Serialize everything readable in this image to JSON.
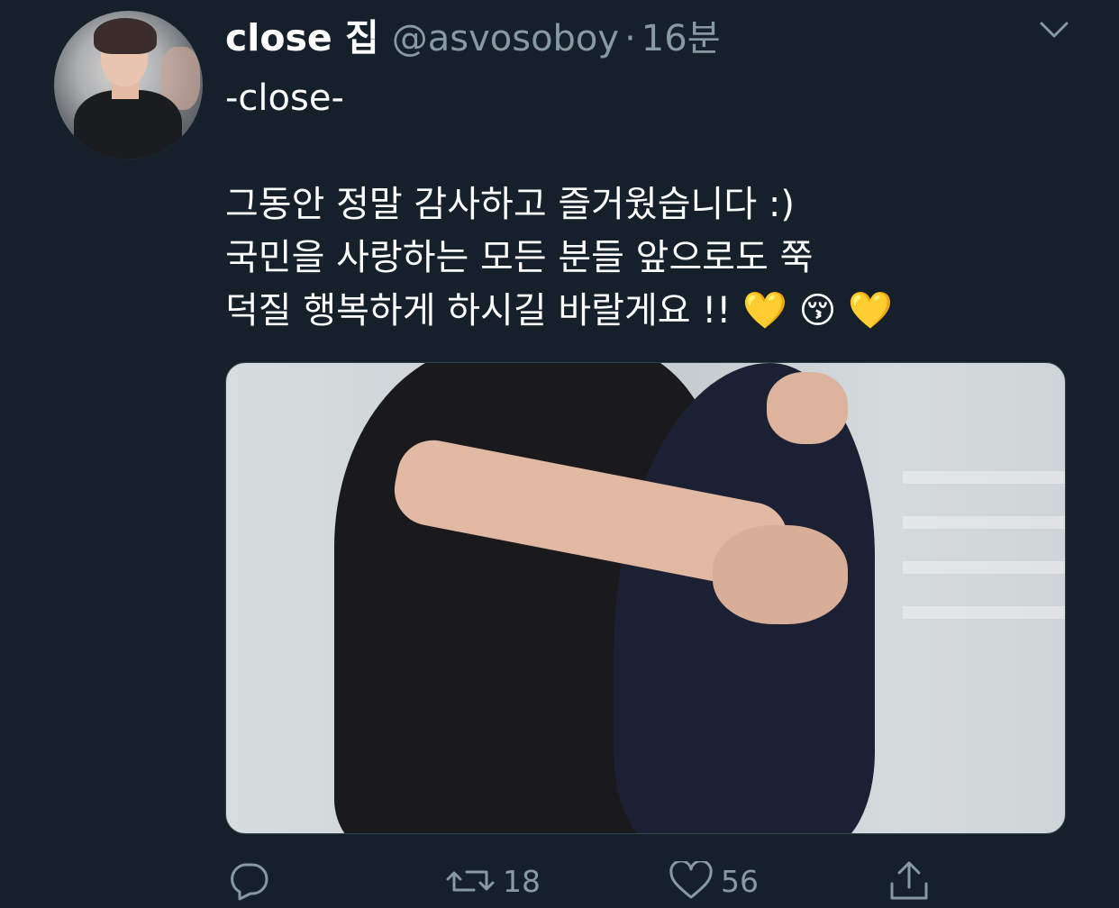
{
  "tweet": {
    "display_name": "close 집",
    "handle": "@asvosoboy",
    "separator": "·",
    "time": "16분",
    "text_lines": [
      "-close-",
      "",
      "그동안 정말 감사하고 즐거웠습니다 :)",
      "국민을 사랑하는 모든 분들 앞으로도 쭉",
      "덕질 행복하게 하시길 바랄게요 !! 💛 😚 💛"
    ]
  },
  "actions": {
    "reply": {
      "icon": "reply-icon",
      "count": ""
    },
    "retweet": {
      "icon": "retweet-icon",
      "count": "18"
    },
    "like": {
      "icon": "heart-icon",
      "count": "56"
    },
    "share": {
      "icon": "share-icon",
      "count": ""
    }
  },
  "colors": {
    "background": "#15202b",
    "text_primary": "#ffffff",
    "text_secondary": "#8899a6",
    "border": "#38444d"
  }
}
